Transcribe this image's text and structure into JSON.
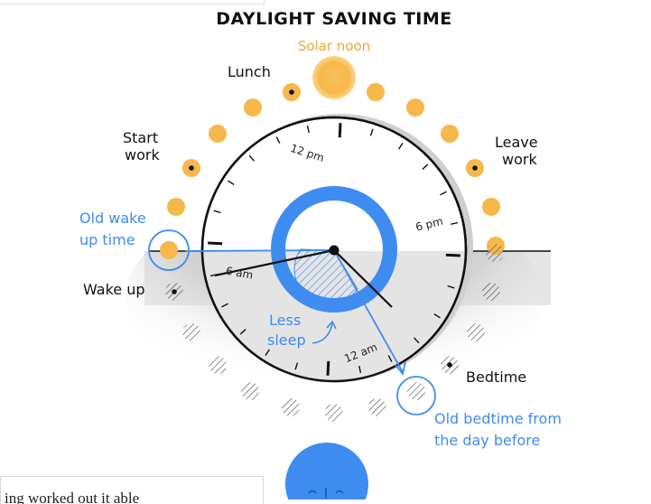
{
  "title": "DAYLIGHT SAVING TIME",
  "labels": {
    "solar_noon": "Solar noon",
    "lunch": "Lunch",
    "start_work": [
      "Start",
      "work"
    ],
    "leave_work": [
      "Leave",
      "work"
    ],
    "old_wake_up_time": [
      "Old wake",
      "up time"
    ],
    "wake_up": "Wake up",
    "less_sleep": [
      "Less",
      "sleep"
    ],
    "bedtime": "Bedtime",
    "old_bedtime": [
      "Old bedtime from",
      "the day before"
    ]
  },
  "clock": {
    "tick_labels": {
      "noon": "12 pm",
      "six_pm": "6 pm",
      "six_am": "6 am",
      "midnight": "12 am"
    }
  },
  "caption": "ing worked out it able",
  "colors": {
    "sun": "#f7b84b",
    "blue": "#3f8cf0",
    "night": "#cfcfcf",
    "ink": "#111111"
  }
}
